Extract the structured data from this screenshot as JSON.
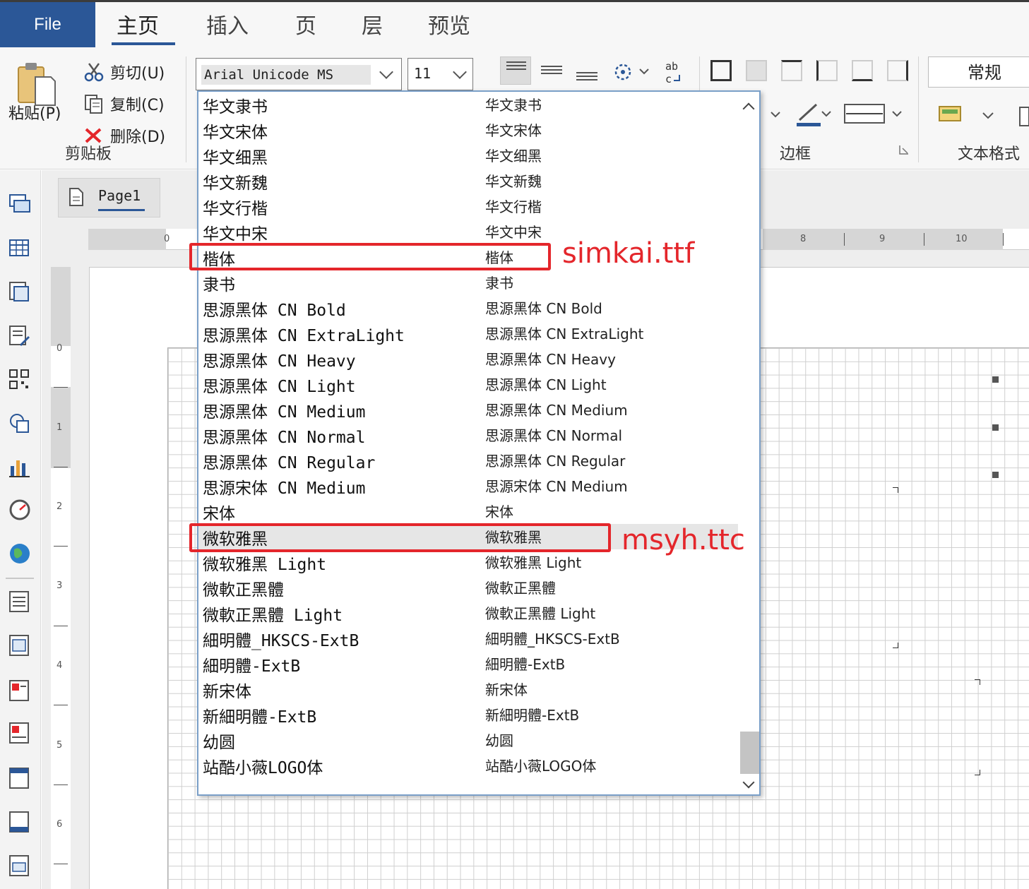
{
  "ribbon_tabs": {
    "file": "File",
    "home": "主页",
    "insert": "插入",
    "page": "页",
    "layer": "层",
    "preview": "预览"
  },
  "clipboard": {
    "paste": "粘贴(P)",
    "cut": "剪切(U)",
    "copy": "复制(C)",
    "delete": "删除(D)",
    "group_label": "剪贴板"
  },
  "font": {
    "current_font": "Arial Unicode MS",
    "current_size": "11"
  },
  "border_group_label": "边框",
  "text_format": {
    "style_value": "常规",
    "group_label": "文本格式"
  },
  "page_tab": "Page1",
  "ruler": {
    "h": [
      "0",
      "8",
      "9",
      "10"
    ],
    "v": [
      "0",
      "1",
      "2",
      "3",
      "4",
      "5",
      "6"
    ]
  },
  "font_list": [
    {
      "name": "华文隶书",
      "preview": "华文隶书"
    },
    {
      "name": "华文宋体",
      "preview": "华文宋体"
    },
    {
      "name": "华文细黑",
      "preview": "华文细黑"
    },
    {
      "name": "华文新魏",
      "preview": "华文新魏"
    },
    {
      "name": "华文行楷",
      "preview": "华文行楷"
    },
    {
      "name": "华文中宋",
      "preview": "华文中宋"
    },
    {
      "name": "楷体",
      "preview": "楷体"
    },
    {
      "name": "隶书",
      "preview": "隶书"
    },
    {
      "name": "思源黑体 CN Bold",
      "preview": "思源黑体 CN Bold"
    },
    {
      "name": "思源黑体 CN ExtraLight",
      "preview": "思源黑体 CN ExtraLight"
    },
    {
      "name": "思源黑体 CN Heavy",
      "preview": "思源黑体 CN Heavy"
    },
    {
      "name": "思源黑体 CN Light",
      "preview": "思源黑体 CN Light"
    },
    {
      "name": "思源黑体 CN Medium",
      "preview": "思源黑体 CN Medium"
    },
    {
      "name": "思源黑体 CN Normal",
      "preview": "思源黑体 CN Normal"
    },
    {
      "name": "思源黑体 CN Regular",
      "preview": "思源黑体 CN Regular"
    },
    {
      "name": "思源宋体 CN Medium",
      "preview": "思源宋体 CN Medium"
    },
    {
      "name": "宋体",
      "preview": "宋体"
    },
    {
      "name": "微软雅黑",
      "preview": "微软雅黑"
    },
    {
      "name": "微软雅黑 Light",
      "preview": "微软雅黑 Light"
    },
    {
      "name": "微軟正黑體",
      "preview": "微軟正黑體"
    },
    {
      "name": "微軟正黑體 Light",
      "preview": "微軟正黑體 Light"
    },
    {
      "name": "細明體_HKSCS-ExtB",
      "preview": "細明體_HKSCS-ExtB"
    },
    {
      "name": "細明體-ExtB",
      "preview": "細明體-ExtB"
    },
    {
      "name": "新宋体",
      "preview": "新宋体"
    },
    {
      "name": "新細明體-ExtB",
      "preview": "新細明體-ExtB"
    },
    {
      "name": "幼圆",
      "preview": "幼圆"
    },
    {
      "name": "站酷小薇LOGO体",
      "preview": "站酷小薇LOGO体"
    }
  ],
  "annotations": {
    "kaiti": "simkai.ttf",
    "yahei": "msyh.ttc"
  },
  "colors": {
    "accent": "#2b5797",
    "annotation": "#e4262b"
  }
}
